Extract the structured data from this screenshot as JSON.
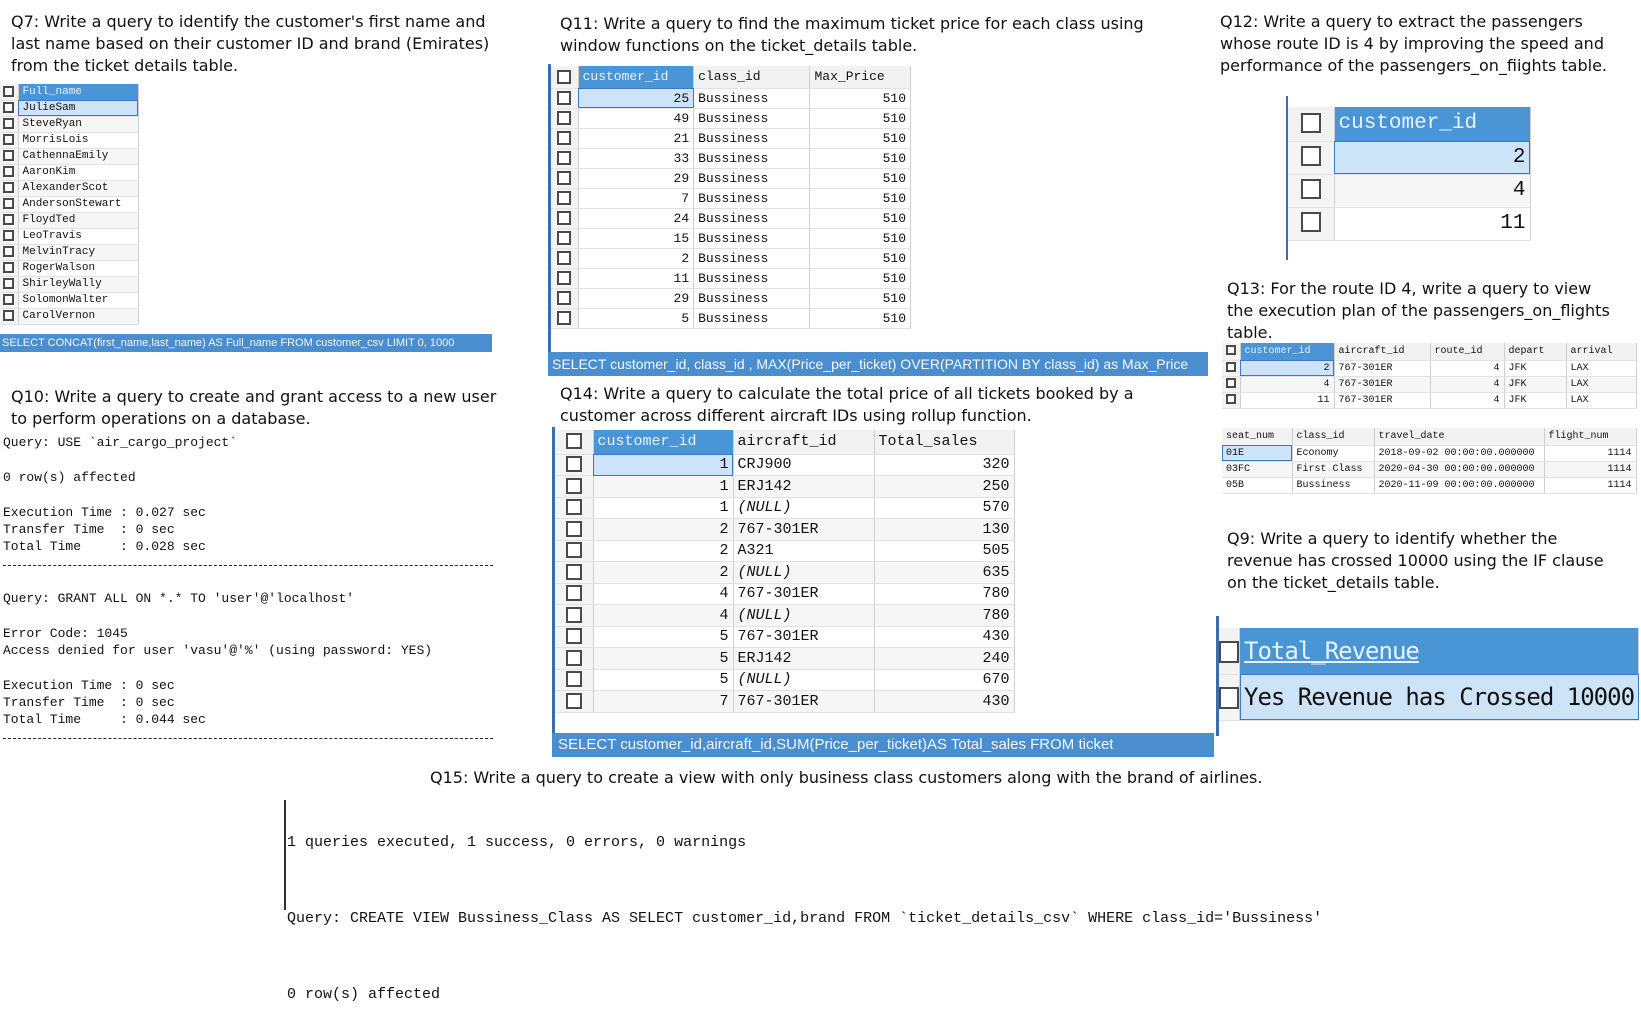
{
  "q7": {
    "title": "Q7: Write a query to identify the customer's first name and last name based on their customer ID and brand (Emirates) from the ticket details table.",
    "header": "Full_name",
    "rows": [
      "JulieSam",
      "SteveRyan",
      "MorrisLois",
      "CathennaEmily",
      "AaronKim",
      "AlexanderScot",
      "AndersonStewart",
      "FloydTed",
      "LeoTravis",
      "MelvinTracy",
      "RogerWalson",
      "ShirleyWally",
      "SolomonWalter",
      "CarolVernon"
    ],
    "status": "SELECT CONCAT(first_name,last_name) AS Full_name FROM customer_csv LIMIT 0, 1000"
  },
  "q11": {
    "title": "Q11: Write a query to find the maximum ticket price for each class using window functions on the ticket_details table.",
    "headers": [
      "customer_id",
      "class_id",
      "Max_Price"
    ],
    "rows": [
      [
        "25",
        "Bussiness",
        "510"
      ],
      [
        "49",
        "Bussiness",
        "510"
      ],
      [
        "21",
        "Bussiness",
        "510"
      ],
      [
        "33",
        "Bussiness",
        "510"
      ],
      [
        "29",
        "Bussiness",
        "510"
      ],
      [
        "7",
        "Bussiness",
        "510"
      ],
      [
        "24",
        "Bussiness",
        "510"
      ],
      [
        "15",
        "Bussiness",
        "510"
      ],
      [
        "2",
        "Bussiness",
        "510"
      ],
      [
        "11",
        "Bussiness",
        "510"
      ],
      [
        "29",
        "Bussiness",
        "510"
      ],
      [
        "5",
        "Bussiness",
        "510"
      ]
    ],
    "status": "SELECT customer_id, class_id , MAX(Price_per_ticket) OVER(PARTITION BY class_id) as Max_Price"
  },
  "q12": {
    "title": "Q12: Write a query to extract the passengers whose route ID is 4 by improving the speed and performance of the passengers_on_fiights table.",
    "header": "customer_id",
    "rows": [
      "2",
      "4",
      "11"
    ]
  },
  "q13": {
    "title": "Q13: For the route ID 4, write a query to view the execution plan of the passengers_on_flights table.",
    "headers1": [
      "customer_id",
      "aircraft_id",
      "route_id",
      "depart",
      "arrival"
    ],
    "rows1": [
      [
        "2",
        "767-301ER",
        "4",
        "JFK",
        "LAX"
      ],
      [
        "4",
        "767-301ER",
        "4",
        "JFK",
        "LAX"
      ],
      [
        "11",
        "767-301ER",
        "4",
        "JFK",
        "LAX"
      ]
    ],
    "headers2": [
      "seat_num",
      "class_id",
      "travel_date",
      "flight_num"
    ],
    "rows2": [
      [
        "01E",
        "Economy",
        "2018-09-02 00:00:00.000000",
        "1114"
      ],
      [
        "03FC",
        "First Class",
        "2020-04-30 00:00:00.000000",
        "1114"
      ],
      [
        "05B",
        "Bussiness",
        "2020-11-09 00:00:00.000000",
        "1114"
      ]
    ]
  },
  "q10": {
    "title": "Q10: Write a query to create and grant access to a new user to perform operations on a database.",
    "lines1": [
      "Query: USE `air_cargo_project`",
      "",
      "0 row(s) affected",
      "",
      "Execution Time : 0.027 sec",
      "Transfer Time  : 0 sec",
      "Total Time     : 0.028 sec"
    ],
    "lines2": [
      "Query: GRANT ALL ON *.* TO 'user'@'localhost'",
      "",
      "Error Code: 1045",
      "Access denied for user 'vasu'@'%' (using password: YES)",
      "",
      "Execution Time : 0 sec",
      "Transfer Time  : 0 sec",
      "Total Time     : 0.044 sec"
    ]
  },
  "q14": {
    "title": "Q14: Write a query to calculate the total price of all tickets booked by a customer across different aircraft IDs using rollup function.",
    "headers": [
      "customer_id",
      "aircraft_id",
      "Total_sales"
    ],
    "rows": [
      [
        "1",
        "CRJ900",
        "320"
      ],
      [
        "1",
        "ERJ142",
        "250"
      ],
      [
        "1",
        "(NULL)",
        "570"
      ],
      [
        "2",
        "767-301ER",
        "130"
      ],
      [
        "2",
        "A321",
        "505"
      ],
      [
        "2",
        "(NULL)",
        "635"
      ],
      [
        "4",
        "767-301ER",
        "780"
      ],
      [
        "4",
        "(NULL)",
        "780"
      ],
      [
        "5",
        "767-301ER",
        "430"
      ],
      [
        "5",
        "ERJ142",
        "240"
      ],
      [
        "5",
        "(NULL)",
        "670"
      ],
      [
        "7",
        "767-301ER",
        "430"
      ]
    ],
    "status": "SELECT customer_id,aircraft_id,SUM(Price_per_ticket)AS Total_sales FROM ticket"
  },
  "q9": {
    "title": "Q9: Write a query to identify whether the revenue has crossed 10000 using the IF clause on the ticket_details table.",
    "header": "Total_Revenue",
    "value": "Yes Revenue has Crossed 10000"
  },
  "q15": {
    "title": "Q15: Write a query to create a view with only business class customers along with the brand of airlines.",
    "line1": "1 queries executed, 1 success, 0 errors, 0 warnings",
    "line2": "Query: CREATE VIEW Bussiness_Class AS SELECT customer_id,brand FROM `ticket_details_csv` WHERE class_id='Bussiness'",
    "line3": "0 row(s) affected"
  }
}
